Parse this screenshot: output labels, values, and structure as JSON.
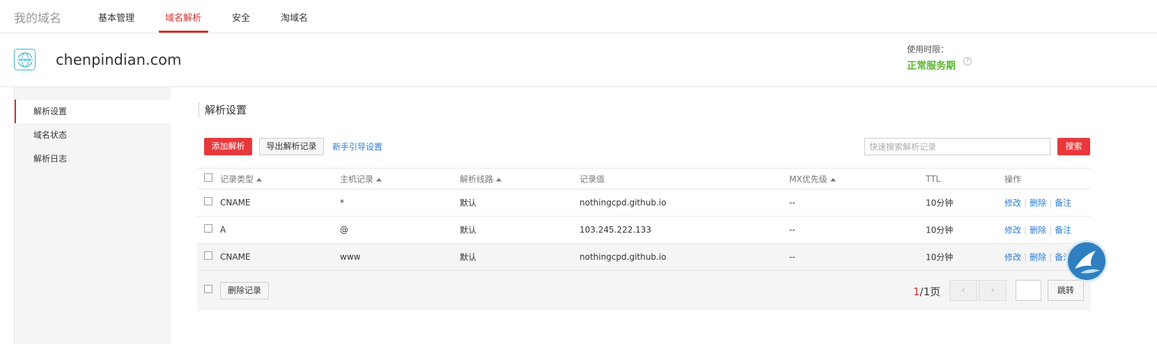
{
  "nav": {
    "brand": "我的域名",
    "tabs": [
      {
        "label": "基本管理"
      },
      {
        "label": "域名解析"
      },
      {
        "label": "安全"
      },
      {
        "label": "淘域名"
      }
    ]
  },
  "domain": {
    "name": "chenpindian.com",
    "usage_label": "使用时限：",
    "usage_status": "正常服务期",
    "usage_status_color": "#5cb531"
  },
  "sidebar": {
    "items": [
      {
        "label": "解析设置"
      },
      {
        "label": "域名状态"
      },
      {
        "label": "解析日志"
      }
    ]
  },
  "main": {
    "title": "解析设置",
    "add_button": "添加解析",
    "export_button": "导出解析记录",
    "guide_link": "新手引导设置",
    "search_placeholder": "快速搜索解析记录",
    "search_button": "搜索"
  },
  "table": {
    "headers": {
      "type": "记录类型",
      "host": "主机记录",
      "line": "解析线路",
      "value": "记录值",
      "mx": "MX优先级",
      "ttl": "TTL",
      "ops": "操作"
    },
    "rows": [
      {
        "type": "CNAME",
        "host": "*",
        "line": "默认",
        "value": "nothingcpd.github.io",
        "mx": "--",
        "ttl": "10分钟"
      },
      {
        "type": "A",
        "host": "@",
        "line": "默认",
        "value": "103.245.222.133",
        "mx": "--",
        "ttl": "10分钟"
      },
      {
        "type": "CNAME",
        "host": "www",
        "line": "默认",
        "value": "nothingcpd.github.io",
        "mx": "--",
        "ttl": "10分钟"
      }
    ],
    "ops": {
      "edit": "修改",
      "delete": "删除",
      "note": "备注"
    },
    "ops_separator": "|",
    "delete_records_button": "删除记录"
  },
  "pager": {
    "current": "1",
    "total_text": "/1页",
    "prev": "‹",
    "next": "›",
    "jump_button": "跳转"
  },
  "colors": {
    "accent": "#d9302b",
    "link": "#2e7dd1",
    "button_red": "#e7383b"
  },
  "icons": [
    "www-icon",
    "help-icon",
    "sort-icon",
    "bird-icon"
  ]
}
